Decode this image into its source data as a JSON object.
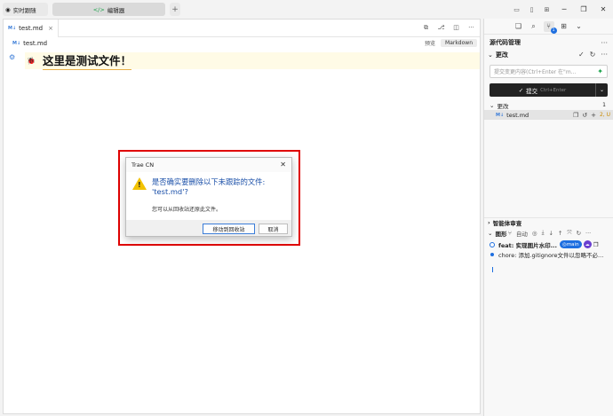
{
  "titlebar": {
    "realtime_label": "实时跟随",
    "editor_label": "编辑器",
    "add_label": "+"
  },
  "editor": {
    "tab": {
      "badge": "M↓",
      "name": "test.md",
      "close": "×"
    },
    "breadcrumb": {
      "badge": "M↓",
      "name": "test.md"
    },
    "preview_label": "预览",
    "markdown_label": "Markdown",
    "heading": "这里是测试文件！"
  },
  "panel": {
    "title": "源代码管理",
    "changes_section": "更改",
    "commit_input_placeholder": "提交变更内容(Ctrl+Enter 在\"m...",
    "commit_label": "提交",
    "commit_shortcut": "Ctrl+Enter",
    "changes_group": "更改",
    "changes_count": "1",
    "file": {
      "badge": "M↓",
      "name": "test.md",
      "status": "2, U"
    },
    "source_control_badge": "1",
    "ai_review_label": "智能体审查",
    "graph_label": "图形",
    "graph_auto": "自动",
    "graph_commits": [
      {
        "message": "feat: 实现图片水印...",
        "branch": "main"
      },
      {
        "message": "chore: 添加.gitignore文件以忽略不必..."
      }
    ]
  },
  "dialog": {
    "title": "Trae CN",
    "message_line1": "是否确实要删除以下未跟踪的文件:",
    "message_line2": "'test.md'?",
    "sub_message": "您可以从回收站还原此文件。",
    "primary_button": "移动到回收站",
    "cancel_button": "取消"
  },
  "colors": {
    "accent": "#1e6fe0",
    "highlight_border": "#e00000",
    "dialog_message": "#1a4fa8",
    "warning": "#f2c200"
  }
}
